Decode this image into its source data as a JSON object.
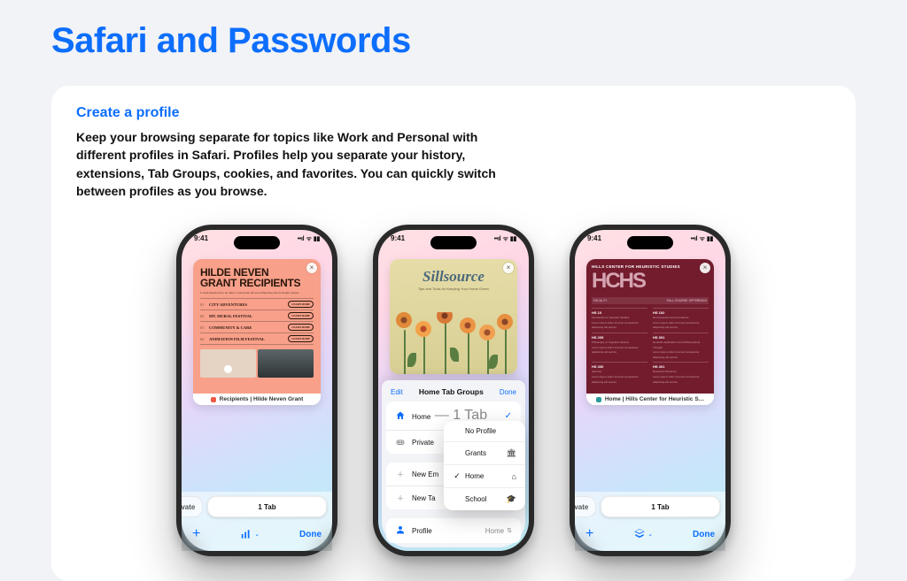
{
  "page": {
    "title": "Safari and Passwords",
    "feature_heading": "Create a profile",
    "feature_body": "Keep your browsing separate for topics like Work and Personal with different profiles in Safari. Profiles help you separate your history, extensions, Tab Groups, cookies, and favorites. You can quickly switch between profiles as you browse."
  },
  "status": {
    "time": "9:41",
    "indicators": "●●● ▮"
  },
  "bottom": {
    "private": "Private",
    "onetab": "1 Tab",
    "done": "Done",
    "plus": "+"
  },
  "left": {
    "tab_title": "Recipients | Hilde Neven Grant",
    "heading1": "HILDE NEVEN",
    "heading2": "GRANT RECIPIENTS",
    "items": [
      {
        "n": "01",
        "t": "CITY ADVENTURES",
        "b": "LEARN MORE"
      },
      {
        "n": "02",
        "t": "MT. MURAL FESTIVAL",
        "b": "LEARN MORE"
      },
      {
        "n": "03",
        "t": "COMMUNITY & CARE",
        "b": "LEARN MORE"
      },
      {
        "n": "04",
        "t": "ANIMATION FILM FESTIVAL",
        "b": "LEARN MORE"
      }
    ]
  },
  "middle": {
    "brand": "Sillsource",
    "tagline": "Tips and Tools for Keeping\nYour Home Green",
    "sheet_title": "Home Tab Groups",
    "edit": "Edit",
    "done": "Done",
    "row_home": "Home",
    "row_home_sub": " — 1 Tab",
    "row_private": "Private",
    "row_new_empty": "New Empty Tab Group",
    "row_new_tab": "New Tab Group",
    "row_profile": "Profile",
    "row_profile_value": "Home",
    "popover": [
      {
        "chk": "",
        "label": "No Profile",
        "glyph": ""
      },
      {
        "chk": "",
        "label": "Grants",
        "glyph": "🏛"
      },
      {
        "chk": "✓",
        "label": "Home",
        "glyph": "⌂"
      },
      {
        "chk": "",
        "label": "School",
        "glyph": "🎓"
      }
    ]
  },
  "right": {
    "tab_title": "Home | Hills Center for Heuristic S…",
    "banner": "HILLS CENTER FOR HEURISTIC STUDIES",
    "logo": "HCHS",
    "subbar_left": "FACULTY",
    "subbar_right": "FALL COURSE OFFERINGS",
    "courses": [
      {
        "code": "HS 10",
        "name": "Introduction to Heuristic Studies"
      },
      {
        "code": "HS 102",
        "name": "Hermeneutics Across Cultures"
      },
      {
        "code": "HS 205",
        "name": "Philosophy of Cognitive Models"
      },
      {
        "code": "HS 301",
        "name": "Heuristic Aesthetics II and Philosophical Thought"
      },
      {
        "code": "HS 330",
        "name": "Seminar"
      },
      {
        "code": "HS 401",
        "name": "Research Practicum"
      }
    ]
  }
}
